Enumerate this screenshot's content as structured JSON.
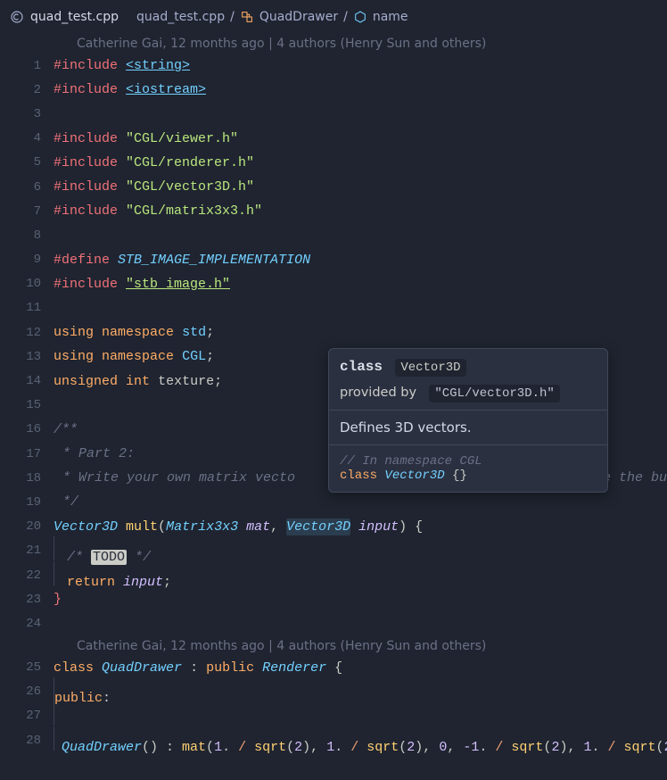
{
  "breadcrumb": {
    "file": "quad_test.cpp",
    "crumbs": [
      "quad_test.cpp",
      "QuadDrawer",
      "name"
    ]
  },
  "blame": {
    "author": "Catherine Gai",
    "age": "12 months ago",
    "authors_summary": "4 authors (Henry Sun and others)"
  },
  "blame2": {
    "author": "Catherine Gai",
    "age": "12 months ago",
    "authors_summary": "4 authors (Henry Sun and others)"
  },
  "code": {
    "include_directive": "#include",
    "define_directive": "#define",
    "using_kw": "using",
    "namespace_kw": "namespace",
    "return_kw": "return",
    "class_kw": "class",
    "public_kw": "public",
    "unsigned_kw": "unsigned",
    "int_kw": "int",
    "inc_string": "<string>",
    "inc_iostream": "<iostream>",
    "inc_viewer": "\"CGL/viewer.h\"",
    "inc_renderer": "\"CGL/renderer.h\"",
    "inc_vector3d": "\"CGL/vector3D.h\"",
    "inc_matrix3x3": "\"CGL/matrix3x3.h\"",
    "macro_stb": "STB_IMAGE_IMPLEMENTATION",
    "inc_stb": "\"stb_image.h\"",
    "ns_std": "std",
    "ns_cgl": "CGL",
    "texture_var": "texture",
    "comment_open": "/**",
    "comment_l2": " * Part 2:",
    "comment_l3": " * Write your own matrix vecto",
    "comment_l3_tail": "e the bu",
    "comment_close": " */",
    "type_vector3d": "Vector3D",
    "type_matrix3x3": "Matrix3x3",
    "type_renderer": "Renderer",
    "func_mult": "mult",
    "func_sqrt": "sqrt",
    "param_mat": "mat",
    "param_input": "input",
    "todo_prefix": "/* ",
    "todo_word": "TODO",
    "todo_suffix": " */",
    "class_quaddrawer": "QuadDrawer",
    "ctor_quaddrawer": "QuadDrawer",
    "member_mat": "mat",
    "num_1": "1",
    "num_2": "2",
    "num_0": "0",
    "num_neg1": "-1"
  },
  "hover": {
    "kw": "class",
    "type": "Vector3D",
    "provided_label": "provided by",
    "provided_path": "\"CGL/vector3D.h\"",
    "desc": "Defines 3D vectors.",
    "sample_comment": "// In namespace CGL",
    "sample_kw": "class",
    "sample_type": "Vector3D",
    "sample_braces": "{}"
  },
  "line_numbers": [
    "1",
    "2",
    "3",
    "4",
    "5",
    "6",
    "7",
    "8",
    "9",
    "10",
    "11",
    "12",
    "13",
    "14",
    "15",
    "16",
    "17",
    "18",
    "19",
    "20",
    "21",
    "22",
    "23",
    "24",
    "25",
    "26",
    "27",
    "28"
  ]
}
